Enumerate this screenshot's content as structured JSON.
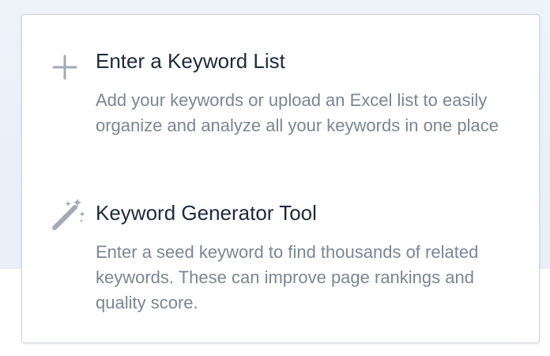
{
  "panel": {
    "options": [
      {
        "icon": "plus-icon",
        "title": "Enter a Keyword List",
        "description": "Add your keywords or upload an Excel list to easily organize and analyze all your keywords in one place"
      },
      {
        "icon": "magic-wand-icon",
        "title": "Keyword Generator Tool",
        "description": "Enter a seed keyword to find thousands of related keywords. These can improve page rankings and quality score."
      }
    ]
  },
  "colors": {
    "title_text": "#1d2a3d",
    "description_text": "#7b8594",
    "icon": "#a2aab6",
    "card_border": "#d3d8e0"
  }
}
